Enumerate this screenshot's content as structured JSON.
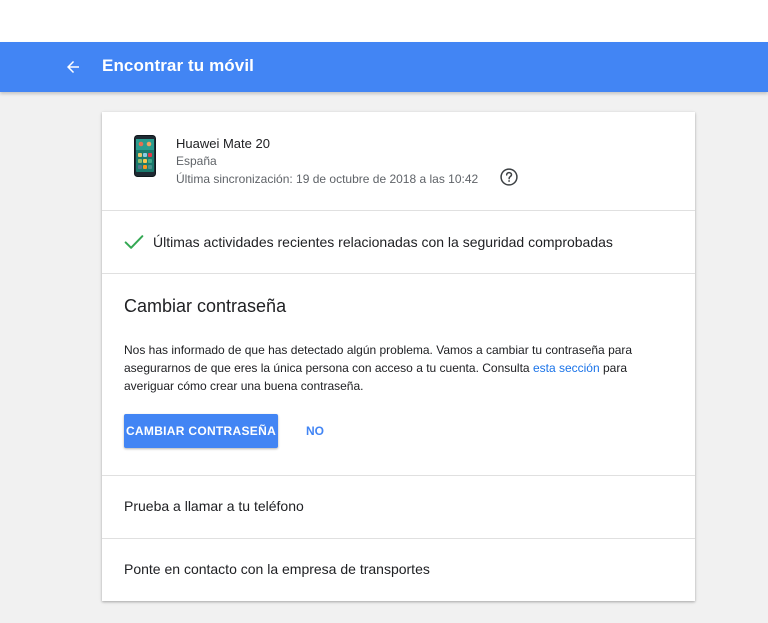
{
  "header": {
    "title": "Encontrar tu móvil",
    "back_icon": "arrow-back-icon",
    "color": "#4285f4"
  },
  "device": {
    "name": "Huawei Mate 20",
    "country": "España",
    "last_sync": "Última sincronización: 19 de octubre de 2018 a las 10:42",
    "icon": "phone-icon",
    "help_icon": "help-circle-icon"
  },
  "security": {
    "status_text": "Últimas actividades recientes relacionadas con la seguridad comprobadas",
    "icon": "check-icon",
    "icon_color": "#34a853"
  },
  "change_password": {
    "title": "Cambiar contraseña",
    "description_before_link": "Nos has informado de que has detectado algún problema. Vamos a cambiar tu contraseña para asegurarnos de que eres la única persona con acceso a tu cuenta. Consulta ",
    "link_text": "esta sección",
    "description_after_link": " para averiguar cómo crear una buena contraseña.",
    "primary_button": "CAMBIAR CONTRASEÑA",
    "secondary_button": "NO"
  },
  "options": {
    "call_phone": "Prueba a llamar a tu teléfono",
    "contact_carrier": "Ponte en contacto con la empresa de transportes"
  }
}
